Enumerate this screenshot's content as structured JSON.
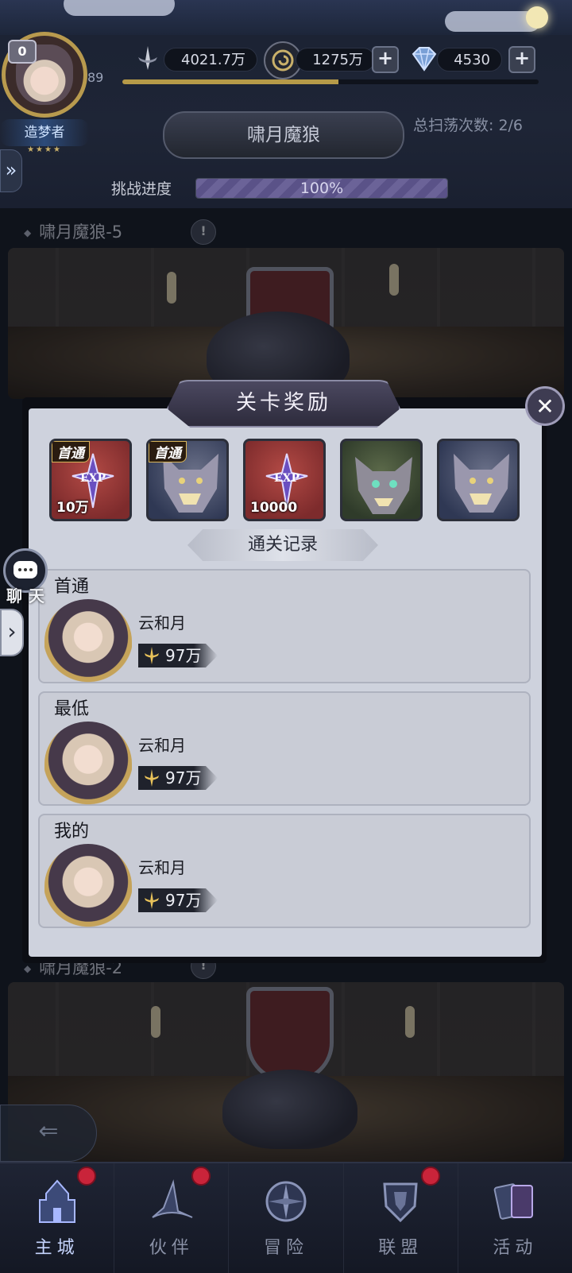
{
  "player": {
    "vip_level": "0",
    "level": "89",
    "title": "造梦者",
    "stars": "★★★★"
  },
  "resources": {
    "power": "4021.7万",
    "gold": "1275万",
    "diamond": "4530",
    "exp_progress_fraction": 0.52
  },
  "boss": {
    "name": "啸月魔狼",
    "sweep_count": "总扫荡次数: 2/6",
    "progress_label": "挑战进度",
    "progress_text": "100%",
    "progress_fraction": 1.0
  },
  "stages": [
    {
      "name": "啸月魔狼-5",
      "info_icon": "!"
    },
    {
      "name": "啸月魔狼-2",
      "info_icon": "!"
    }
  ],
  "modal": {
    "title": "关卡奖励",
    "close_icon": "✕",
    "rewards": [
      {
        "type": "exp",
        "amount": "10万",
        "first_clear": "首通",
        "color": "red"
      },
      {
        "type": "wolf-fragment",
        "amount": "",
        "first_clear": "首通",
        "color": "blue"
      },
      {
        "type": "exp",
        "amount": "10000",
        "first_clear": "",
        "color": "red"
      },
      {
        "type": "wolf-green",
        "amount": "",
        "first_clear": "",
        "color": "green"
      },
      {
        "type": "wolf-fragment",
        "amount": "",
        "first_clear": "",
        "color": "blue"
      }
    ],
    "records_title": "通关记录",
    "records": [
      {
        "label": "首通",
        "player": "云和月",
        "power": "97万"
      },
      {
        "label": "最低",
        "player": "云和月",
        "power": "97万"
      },
      {
        "label": "我的",
        "player": "云和月",
        "power": "97万"
      }
    ]
  },
  "chat": {
    "label": "聊天"
  },
  "nav": [
    {
      "label": "主城",
      "active": true,
      "badge": true
    },
    {
      "label": "伙伴",
      "active": false,
      "badge": true
    },
    {
      "label": "冒险",
      "active": false,
      "badge": false
    },
    {
      "label": "联盟",
      "active": false,
      "badge": true
    },
    {
      "label": "活动",
      "active": false,
      "badge": false
    }
  ],
  "colors": {
    "accent_gold": "#b69a48",
    "progress_purple": "#6b6398",
    "badge_red": "#c9243a",
    "modal_bg": "#ced2dd"
  }
}
